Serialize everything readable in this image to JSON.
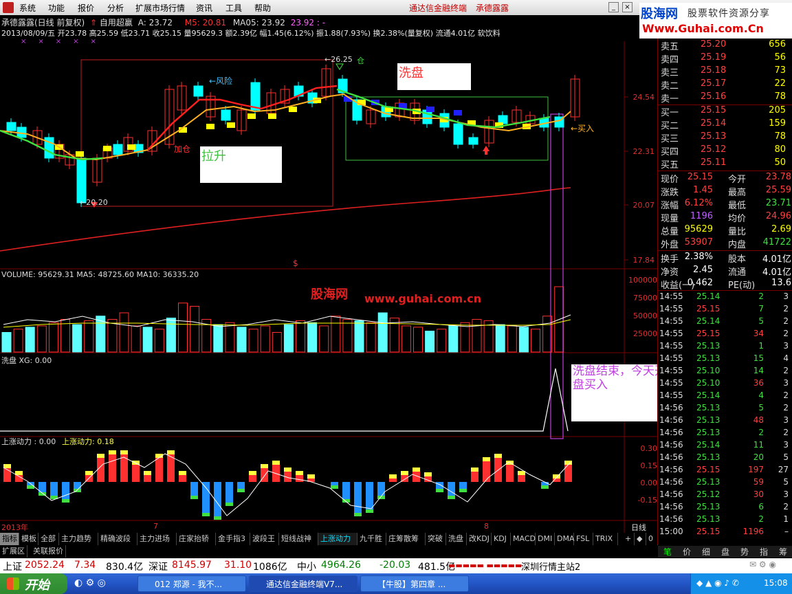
{
  "menu": {
    "items": [
      "系统",
      "功能",
      "报价",
      "分析",
      "扩展市场行情",
      "资讯",
      "工具",
      "帮助"
    ],
    "center_title": "通达信金融终端",
    "center_stock": "承德露露"
  },
  "logo": {
    "line1": "股海网",
    "line1b": "股票软件资源分享",
    "line2": "Www.Guhai.com.Cn"
  },
  "chart_header": {
    "title": "承德露露(日线 前复权)",
    "mode": "自用超赢",
    "a_value": "A: 23.72",
    "ma5": "M5: 20.81",
    "ma05": "MA05: 23.92",
    "ma05b": "23.92 : -",
    "ohlc": "2013/08/09/五 开23.78 高25.59 低23.71 收25.15 量95629.3 额2.39亿 幅1.45(6.12%) 振1.88(7.93%) 换2.38%(量复权) 流通4.01亿 软饮料"
  },
  "price_axis": [
    "24.54",
    "22.31",
    "20.07",
    "17.84"
  ],
  "annotations": {
    "risk": "←风险",
    "add": "加仓",
    "lift": "拉升",
    "wash": "洗盘",
    "low": "←20.20",
    "high": "←26.25",
    "buy": "←买入",
    "end": "洗盘结束，今天开盘买入",
    "high_note": "仓",
    "wm_cn": "股海网",
    "wm_url": "www.guhai.com.cn",
    "dollar": "$",
    "wash_label": "洗盘"
  },
  "volume_panel": {
    "label": "VOLUME: 95629.31  MA5: 48725.60  MA10: 36335.20",
    "axis": [
      "100000",
      "75000",
      "50000",
      "25000"
    ]
  },
  "xg_panel": {
    "label": "洗盘  XG: 0.00"
  },
  "momentum_panel": {
    "label_a": "上涨动力 : 0.00",
    "label_b": "上涨动力: 0.18",
    "axis": [
      "0.30",
      "0.15",
      "0.00",
      "-0.15"
    ]
  },
  "time_axis": {
    "year": "2013年",
    "m7": "7",
    "m8": "8",
    "period": "日线"
  },
  "tabs": [
    "指标",
    "模板",
    "全部",
    "主力趋势",
    "精确波段",
    "主力进场",
    "庄家抬轿",
    "金手指3",
    "波段王",
    "短线战神",
    "上涨动力",
    "九千胜",
    "庄筹散筹",
    "突破",
    "洗盘",
    "改KDJ",
    "KDJ",
    "MACD",
    "DMI",
    "DMA",
    "FSL",
    "TRIX"
  ],
  "tab_ctrls": [
    "+",
    "◆",
    "0"
  ],
  "tabs2": [
    "扩展区",
    "关联报价"
  ],
  "quote": {
    "sell": [
      {
        "n": "卖五",
        "p": "25.20",
        "v": "656"
      },
      {
        "n": "卖四",
        "p": "25.19",
        "v": "56"
      },
      {
        "n": "卖三",
        "p": "25.18",
        "v": "73"
      },
      {
        "n": "卖二",
        "p": "25.17",
        "v": "22"
      },
      {
        "n": "卖一",
        "p": "25.16",
        "v": "78"
      }
    ],
    "buy": [
      {
        "n": "买一",
        "p": "25.15",
        "v": "205"
      },
      {
        "n": "买二",
        "p": "25.14",
        "v": "159"
      },
      {
        "n": "买三",
        "p": "25.13",
        "v": "78"
      },
      {
        "n": "买四",
        "p": "25.12",
        "v": "80"
      },
      {
        "n": "买五",
        "p": "25.11",
        "v": "50"
      }
    ],
    "stats": [
      [
        "现价",
        "25.15",
        "今开",
        "23.78"
      ],
      [
        "涨跌",
        "1.45",
        "最高",
        "25.59"
      ],
      [
        "涨幅",
        "6.12%",
        "最低",
        "23.71"
      ],
      [
        "现量",
        "1196",
        "均价",
        "24.96"
      ],
      [
        "总量",
        "95629",
        "量比",
        "2.69"
      ],
      [
        "外盘",
        "53907",
        "内盘",
        "41722"
      ],
      [
        "换手",
        "2.38%",
        "股本",
        "4.01亿"
      ],
      [
        "净资",
        "2.45",
        "流通",
        "4.01亿"
      ],
      [
        "收益(一)",
        "0.462",
        "PE(动)",
        "13.6"
      ]
    ],
    "ticks": [
      [
        "14:55",
        "25.14",
        "2",
        "3"
      ],
      [
        "14:55",
        "25.15",
        "7",
        "2"
      ],
      [
        "14:55",
        "25.14",
        "5",
        "2"
      ],
      [
        "14:55",
        "25.15",
        "34",
        "2"
      ],
      [
        "14:55",
        "25.13",
        "1",
        "3"
      ],
      [
        "14:55",
        "25.13",
        "15",
        "4"
      ],
      [
        "14:55",
        "25.10",
        "14",
        "2"
      ],
      [
        "14:55",
        "25.10",
        "36",
        "3"
      ],
      [
        "14:55",
        "25.14",
        "4",
        "2"
      ],
      [
        "14:56",
        "25.13",
        "5",
        "2"
      ],
      [
        "14:56",
        "25.13",
        "48",
        "3"
      ],
      [
        "14:56",
        "25.13",
        "2",
        "2"
      ],
      [
        "14:56",
        "25.14",
        "11",
        "3"
      ],
      [
        "14:56",
        "25.13",
        "20",
        "5"
      ],
      [
        "14:56",
        "25.15",
        "197",
        "27"
      ],
      [
        "14:56",
        "25.13",
        "59",
        "5"
      ],
      [
        "14:56",
        "25.12",
        "30",
        "3"
      ],
      [
        "14:56",
        "25.13",
        "6",
        "2"
      ],
      [
        "14:56",
        "25.13",
        "2",
        "1"
      ],
      [
        "15:00",
        "25.15",
        "1196",
        "–"
      ]
    ],
    "bottom_tabs": [
      "笔",
      "价",
      "细",
      "盘",
      "势",
      "指",
      "筹"
    ]
  },
  "status": {
    "sh": "上证",
    "sh_v": "2052.24",
    "sh_c": "7.34",
    "sh_a": "830.4亿",
    "sz": "深证",
    "sz_v": "8145.97",
    "sz_c": "31.10",
    "sz_a": "1086亿",
    "zx": "中小",
    "zx_v": "4964.26",
    "zx_c": "-20.03",
    "zx_a": "481.5亿",
    "server": "深圳行情主站2"
  },
  "taskbar": {
    "start": "开始",
    "items": [
      "012 郑源 - 我不...",
      "通达信金融终端V7...",
      "【牛股】第四章 ..."
    ],
    "clock": "15:08"
  },
  "colors": {
    "up": "#ff3030",
    "down": "#00ffff",
    "ma_red": "#ff2020",
    "ma_green": "#40e040",
    "ma_orange": "#ffb020",
    "wash_box": "#40c040",
    "lift_box": "#c02020",
    "purple": "#c040e0"
  }
}
